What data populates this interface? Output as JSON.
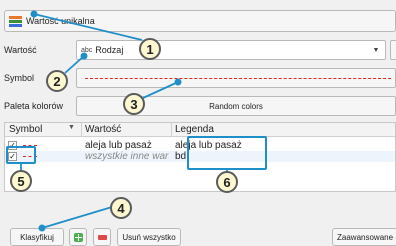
{
  "renderer": {
    "label": "Wartość unikalna"
  },
  "labels": {
    "value": "Wartość",
    "symbol": "Symbol",
    "palette": "Paleta kolorów"
  },
  "value_field": {
    "type_prefix": "abc",
    "value": "Rodzaj"
  },
  "palette_field": {
    "value": "Random colors"
  },
  "table": {
    "headers": [
      "Symbol",
      "Wartość",
      "Legenda"
    ],
    "rows": [
      {
        "checked": true,
        "value": "aleja lub pasaż",
        "legend": "aleja lub pasaż"
      },
      {
        "checked": true,
        "value": "wszystkie inne wartości",
        "legend": "bd."
      }
    ]
  },
  "buttons": {
    "classify": "Klasyfikuj",
    "remove_all": "Usuń wszystko",
    "advanced": "Zaawansowane"
  },
  "callouts": [
    "1",
    "2",
    "3",
    "4",
    "5",
    "6"
  ],
  "colors": {
    "accent": "#1f8fc9",
    "symbol_line": "#e0281e",
    "badge_fill": "#fdf8d0"
  }
}
